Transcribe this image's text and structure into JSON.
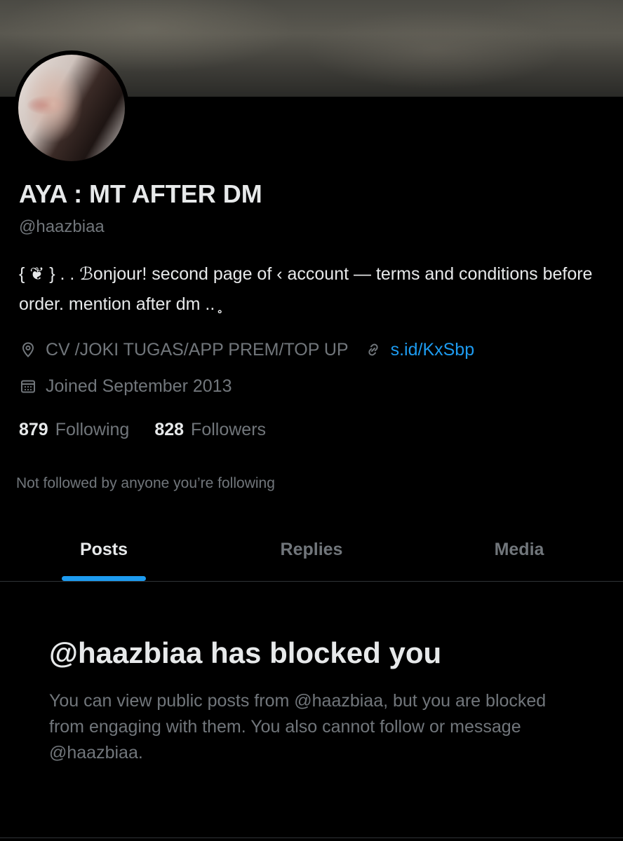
{
  "profile": {
    "display_name": "AYA : MT AFTER DM",
    "handle": "@haazbiaa",
    "bio": "{ ❦ } . . ℬonjour! second page of ‹ account — terms and conditions before order. mention after dm .. ̥̥̥ ",
    "location": "CV /JOKI TUGAS/APP PREM/TOP UP",
    "website": "s.id/KxSbp",
    "joined": "Joined September 2013",
    "following_count": "879",
    "following_label": "Following",
    "followers_count": "828",
    "followers_label": "Followers",
    "followed_by_text": "Not followed by anyone you’re following"
  },
  "tabs": [
    {
      "label": "Posts"
    },
    {
      "label": "Replies"
    },
    {
      "label": "Media"
    }
  ],
  "blocked": {
    "title": "@haazbiaa has blocked you",
    "message": "You can view public posts from @haazbiaa, but you are blocked from engaging with them. You also cannot follow or message @haazbiaa."
  },
  "colors": {
    "accent": "#1d9bf0",
    "background": "#000000",
    "text_primary": "#e7e9ea",
    "text_secondary": "#71767b"
  },
  "icons": {
    "location": "location-pin-icon",
    "link": "link-icon",
    "calendar": "calendar-icon"
  }
}
